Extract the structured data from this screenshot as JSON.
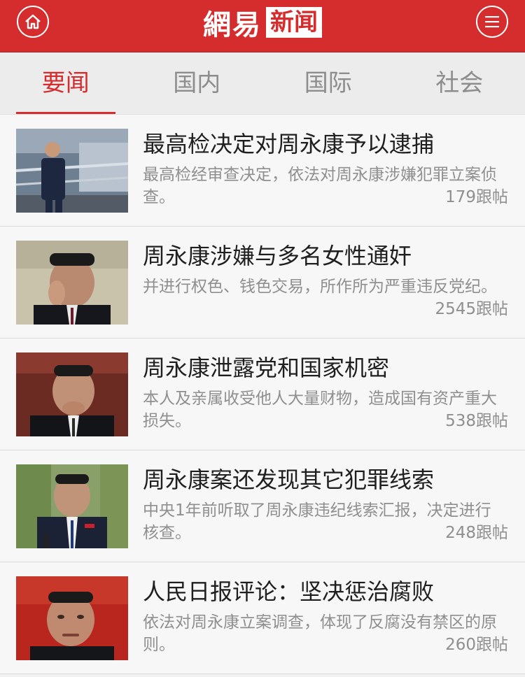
{
  "header": {
    "logo_left": "網易",
    "logo_right": "新闻",
    "home_icon": "home-icon",
    "menu_icon": "hamburger-menu-icon",
    "accent_color": "#d52d2d"
  },
  "tabs": [
    {
      "label": "要闻",
      "active": true
    },
    {
      "label": "国内",
      "active": false
    },
    {
      "label": "国际",
      "active": false
    },
    {
      "label": "社会",
      "active": false
    }
  ],
  "news": [
    {
      "title": "最高检决定对周永康予以逮捕",
      "desc": "最高检经审查决定，依法对周永康涉嫌犯罪立案侦查。",
      "count": "179跟帖"
    },
    {
      "title": "周永康涉嫌与多名女性通奸",
      "desc": "并进行权色、钱色交易，所作所为严重违反党纪。",
      "count": "2545跟帖"
    },
    {
      "title": "周永康泄露党和国家机密",
      "desc": "本人及亲属收受他人大量财物，造成国有资产重大损失。",
      "count": "538跟帖"
    },
    {
      "title": "周永康案还发现其它犯罪线索",
      "desc": "中央1年前听取了周永康违纪线索汇报，决定进行核查。",
      "count": "248跟帖"
    },
    {
      "title": "人民日报评论：坚决惩治腐败",
      "desc": "依法对周永康立案调查，体现了反腐没有禁区的原则。",
      "count": "260跟帖"
    }
  ]
}
